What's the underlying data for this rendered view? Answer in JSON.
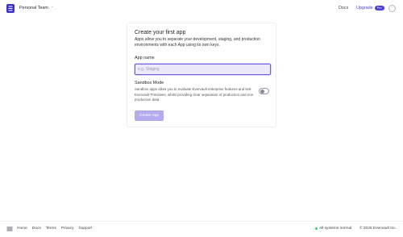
{
  "header": {
    "team_name": "Personal Team",
    "team_chevron_icon": "chevron-updown-icon",
    "docs_label": "Docs",
    "upgrade_label": "Upgrade",
    "pro_badge": "Pro"
  },
  "card": {
    "title": "Create your first app",
    "description": "Apps allow you to separate your development, staging, and production environments with each App using its own keys.",
    "app_name_label": "App name",
    "app_name_value": "",
    "app_name_placeholder": "e.g. Staging",
    "sandbox_title": "Sandbox Mode",
    "sandbox_description": "Sandbox apps allow you to evaluate Evervault enterprise features and test Evervault Primitives, whilst providing clear separation of production and non production data.",
    "sandbox_enabled": false,
    "create_button_label": "Create App"
  },
  "footer": {
    "links": [
      "Home",
      "Docs",
      "Terms",
      "Privacy",
      "Support"
    ],
    "status_text": "All systems normal",
    "copyright": "© 2025 Evervault Inc."
  },
  "colors": {
    "accent": "#4b3fd6",
    "button_disabled": "#b3abee",
    "status_ok": "#2ecc71"
  }
}
